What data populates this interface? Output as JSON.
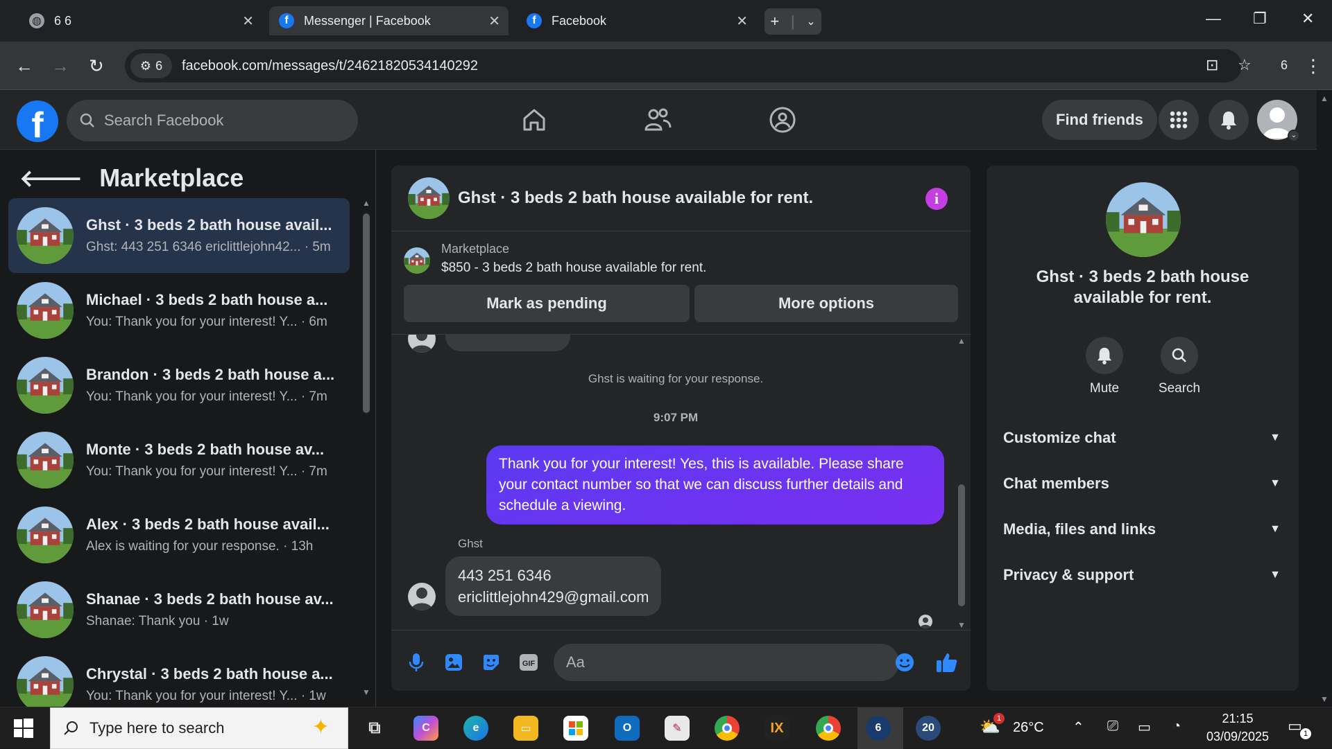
{
  "browser": {
    "tabs": [
      {
        "title": "6 6",
        "icon": "globe-icon",
        "active": false
      },
      {
        "title": "Messenger | Facebook",
        "icon": "facebook-icon",
        "active": true
      },
      {
        "title": "Facebook",
        "icon": "facebook-icon",
        "active": false
      }
    ],
    "site_chip_count": "6",
    "url": "facebook.com/messages/t/24621820534140292",
    "profile_count": "6"
  },
  "fbnav": {
    "search_placeholder": "Search Facebook",
    "find_friends_label": "Find friends"
  },
  "sidebar": {
    "title": "Marketplace",
    "conversations": [
      {
        "name": "Ghst · 3 beds 2 bath house avail...",
        "preview": "Ghst: 443 251 6346 ericlittlejohn42... · 5m",
        "active": true
      },
      {
        "name": "Michael · 3 beds 2 bath house a...",
        "preview": "You: Thank you for your interest! Y... · 6m",
        "active": false
      },
      {
        "name": "Brandon · 3 beds 2 bath house a...",
        "preview": "You: Thank you for your interest! Y... · 7m",
        "active": false
      },
      {
        "name": "Monte · 3 beds 2 bath house av...",
        "preview": "You: Thank you for your interest! Y... · 7m",
        "active": false
      },
      {
        "name": "Alex · 3 beds 2 bath house avail...",
        "preview": "Alex is waiting for your response. · 13h",
        "active": false
      },
      {
        "name": "Shanae · 3 beds 2 bath house av...",
        "preview": "Shanae: Thank you · 1w",
        "active": false
      },
      {
        "name": "Chrystal · 3 beds 2 bath house a...",
        "preview": "You: Thank you for your interest! Y... · 1w",
        "active": false
      }
    ]
  },
  "chat": {
    "title": "Ghst · 3 beds 2 bath house available for rent.",
    "listing_label": "Marketplace",
    "listing_text": "$850 - 3 beds 2 bath house available for rent.",
    "mark_pending_label": "Mark as pending",
    "more_options_label": "More options",
    "system_message": "Ghst is waiting for your response.",
    "timestamp": "9:07 PM",
    "my_message": "Thank you for your interest! Yes, this is available. Please share your contact number so that we can discuss further details and schedule a viewing.",
    "sender_name": "Ghst",
    "their_message_line1": "443 251 6346",
    "their_message_line2": "ericlittlejohn429@gmail.com",
    "input_placeholder": "Aa"
  },
  "details": {
    "title": "Ghst · 3 beds 2 bath house available for rent.",
    "mute_label": "Mute",
    "search_label": "Search",
    "sections": [
      "Customize chat",
      "Chat members",
      "Media, files and links",
      "Privacy & support"
    ]
  },
  "taskbar": {
    "search_placeholder": "Type here to search",
    "weather": "26°C",
    "weather_badge": "1",
    "time": "21:15",
    "date": "03/09/2025",
    "notification_count": "1",
    "app_badge_6": "6",
    "app_badge_20": "20"
  },
  "colors": {
    "accent": "#1877f2",
    "bubble_mine": "#6b32f5",
    "info_icon": "#c43ee0",
    "bg": "#18191a",
    "panel": "#242526"
  }
}
